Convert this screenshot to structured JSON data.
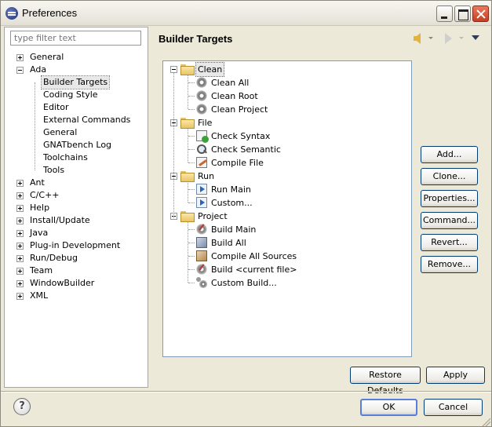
{
  "window": {
    "title": "Preferences"
  },
  "filter": {
    "placeholder": "type filter text"
  },
  "left_tree": [
    {
      "label": "General",
      "level": 0,
      "expander": "plus"
    },
    {
      "label": "Ada",
      "level": 0,
      "expander": "minus"
    },
    {
      "label": "Builder Targets",
      "level": 1,
      "selected": true
    },
    {
      "label": "Coding Style",
      "level": 1
    },
    {
      "label": "Editor",
      "level": 1
    },
    {
      "label": "External Commands",
      "level": 1
    },
    {
      "label": "General",
      "level": 1
    },
    {
      "label": "GNATbench Log",
      "level": 1
    },
    {
      "label": "Toolchains",
      "level": 1
    },
    {
      "label": "Tools",
      "level": 1
    },
    {
      "label": "Ant",
      "level": 0,
      "expander": "plus"
    },
    {
      "label": "C/C++",
      "level": 0,
      "expander": "plus"
    },
    {
      "label": "Help",
      "level": 0,
      "expander": "plus"
    },
    {
      "label": "Install/Update",
      "level": 0,
      "expander": "plus"
    },
    {
      "label": "Java",
      "level": 0,
      "expander": "plus"
    },
    {
      "label": "Plug-in Development",
      "level": 0,
      "expander": "plus"
    },
    {
      "label": "Run/Debug",
      "level": 0,
      "expander": "plus"
    },
    {
      "label": "Team",
      "level": 0,
      "expander": "plus"
    },
    {
      "label": "WindowBuilder",
      "level": 0,
      "expander": "plus"
    },
    {
      "label": "XML",
      "level": 0,
      "expander": "plus"
    }
  ],
  "page": {
    "title": "Builder Targets"
  },
  "targets": [
    {
      "label": "Clean",
      "selected": true,
      "items": [
        {
          "label": "Clean All",
          "icon": "gear-icon"
        },
        {
          "label": "Clean Root",
          "icon": "gear-icon"
        },
        {
          "label": "Clean Project",
          "icon": "gear-icon"
        }
      ]
    },
    {
      "label": "File",
      "items": [
        {
          "label": "Check Syntax",
          "icon": "check-syntax-icon"
        },
        {
          "label": "Check Semantic",
          "icon": "magnifier-icon"
        },
        {
          "label": "Compile File",
          "icon": "compile-icon"
        }
      ]
    },
    {
      "label": "Run",
      "items": [
        {
          "label": "Run Main",
          "icon": "run-icon"
        },
        {
          "label": "Custom...",
          "icon": "run-icon"
        }
      ]
    },
    {
      "label": "Project",
      "items": [
        {
          "label": "Build Main",
          "icon": "build-icon"
        },
        {
          "label": "Build All",
          "icon": "build-all-icon"
        },
        {
          "label": "Compile All Sources",
          "icon": "compile-sources-icon"
        },
        {
          "label": "Build <current file>",
          "icon": "build-icon"
        },
        {
          "label": "Custom Build...",
          "icon": "custom-build-icon"
        }
      ]
    }
  ],
  "side_buttons": [
    "Add...",
    "Clone...",
    "Properties...",
    "Command...",
    "Revert...",
    "Remove..."
  ],
  "footer": {
    "restore_defaults": "Restore Defaults",
    "apply": "Apply",
    "ok": "OK",
    "cancel": "Cancel",
    "help": "?"
  }
}
